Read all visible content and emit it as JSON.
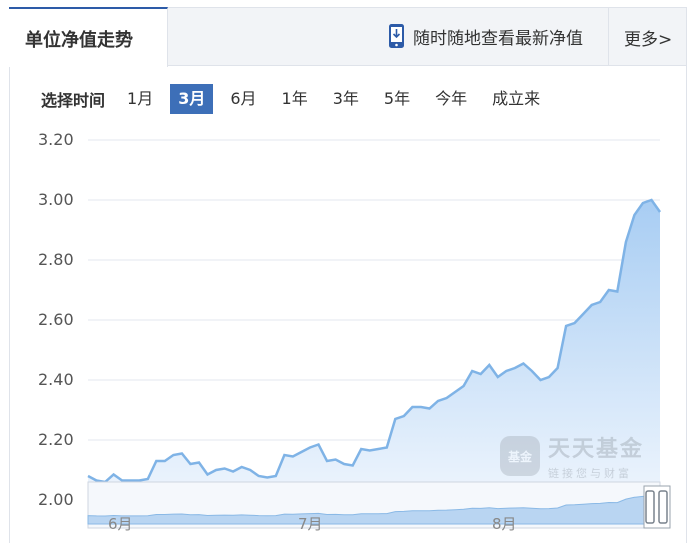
{
  "tabs": {
    "active_label": "单位净值走势",
    "mobile_label": "随时随地查看最新净值",
    "more_label": "更多>"
  },
  "ranges": {
    "label": "选择时间",
    "items": [
      "1月",
      "3月",
      "6月",
      "1年",
      "3年",
      "5年",
      "今年",
      "成立来"
    ],
    "selected": "3月"
  },
  "watermark": {
    "logo": "基金",
    "name": "天天基金",
    "slogan": "链接您与财富"
  },
  "colors": {
    "accent": "#3d6fb8",
    "line": "#7fb3e6",
    "area_top": "#a8cdf3",
    "area_bottom": "#eef5fd"
  },
  "chart_data": {
    "type": "area",
    "y_ticks": [
      "3.20",
      "3.00",
      "2.80",
      "2.60",
      "2.40",
      "2.20",
      "2.00"
    ],
    "ylim": [
      2.0,
      3.2
    ],
    "grid": true,
    "x_ticks": [
      "6月",
      "7月",
      "8月"
    ],
    "series": [
      {
        "values": [
          2.08,
          2.065,
          2.06,
          2.085,
          2.065,
          2.065,
          2.065,
          2.07,
          2.13,
          2.13,
          2.15,
          2.155,
          2.12,
          2.125,
          2.085,
          2.1,
          2.105,
          2.095,
          2.11,
          2.1,
          2.08,
          2.075,
          2.08,
          2.15,
          2.145,
          2.16,
          2.175,
          2.185,
          2.13,
          2.135,
          2.12,
          2.115,
          2.17,
          2.165,
          2.17,
          2.175,
          2.27,
          2.28,
          2.31,
          2.31,
          2.305,
          2.33,
          2.34,
          2.36,
          2.38,
          2.43,
          2.42,
          2.45,
          2.41,
          2.43,
          2.44,
          2.455,
          2.43,
          2.4,
          2.41,
          2.44,
          2.58,
          2.59,
          2.62,
          2.65,
          2.66,
          2.7,
          2.695,
          2.86,
          2.95,
          2.99,
          3.0,
          2.96
        ]
      }
    ]
  }
}
